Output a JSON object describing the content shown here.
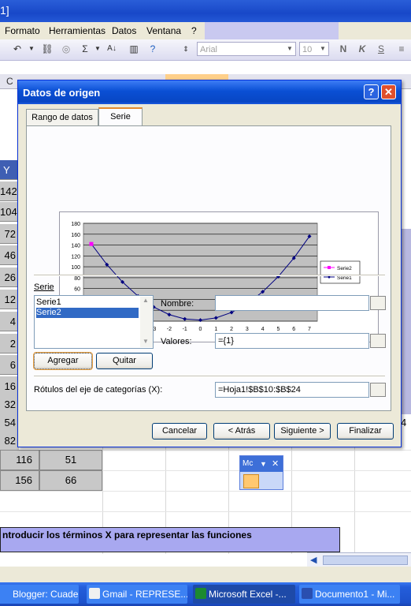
{
  "window": {
    "title_fragment": "1]"
  },
  "menu": {
    "items": [
      "Formato",
      "Herramientas",
      "Datos",
      "Ventana",
      "?"
    ]
  },
  "toolbar": {
    "font_name": "Arial",
    "font_size": "10"
  },
  "sheet": {
    "col_headers": [
      "C"
    ],
    "y_header": "Y",
    "row_values": [
      "142",
      "104",
      "72",
      "46",
      "26",
      "12",
      "4",
      "2",
      "6",
      "16",
      "32",
      "54",
      "82"
    ],
    "extra_rows": [
      {
        "a": "116",
        "b": "51"
      },
      {
        "a": "156",
        "b": "66"
      }
    ],
    "right_value": "4",
    "banner": "ntroducir los términos X para representar las funciones"
  },
  "dialog": {
    "title": "Datos de origen",
    "help_button": "?",
    "tabs": [
      "Rango de datos",
      "Serie"
    ],
    "serie_group_label": "Serie",
    "series_list": [
      "Serie1",
      "Serie2"
    ],
    "selected_series": "Serie2",
    "add_button": "Agregar",
    "remove_button": "Quitar",
    "name_label": "Nombre:",
    "name_value": "",
    "values_label": "Valores:",
    "values_value": "={1}",
    "categories_label": "Rótulos del eje de categorías (X):",
    "categories_value": "=Hoja1!$B$10:$B$24",
    "buttons": {
      "cancel": "Cancelar",
      "back": "< Atrás",
      "next": "Siguiente >",
      "finish": "Finalizar"
    }
  },
  "mini_toolbar": {
    "title": "Mc"
  },
  "taskbar": [
    {
      "label": "Blogger: Cuader...",
      "active": false
    },
    {
      "label": "Gmail - REPRESE...",
      "active": false
    },
    {
      "label": "Microsoft Excel -...",
      "active": true
    },
    {
      "label": "Documento1 - Mi...",
      "active": false
    }
  ],
  "chart_data": {
    "type": "line",
    "x": [
      -7,
      -6,
      -5,
      -4,
      -3,
      -2,
      -1,
      0,
      1,
      2,
      3,
      4,
      5,
      6,
      7
    ],
    "series": [
      {
        "name": "Serie2",
        "color": "#ff00ff",
        "values": [
          142
        ]
      },
      {
        "name": "Serie1",
        "color": "#000080",
        "values": [
          142,
          104,
          72,
          46,
          26,
          12,
          4,
          2,
          6,
          16,
          32,
          54,
          82,
          116,
          156
        ]
      }
    ],
    "y_ticks": [
      0,
      20,
      40,
      60,
      80,
      100,
      120,
      140,
      160,
      180
    ],
    "ylim": [
      0,
      180
    ],
    "grid": true,
    "legend": "right"
  }
}
